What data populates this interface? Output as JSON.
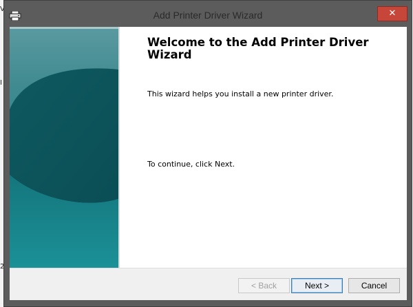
{
  "window": {
    "title": "Add Printer Driver Wizard",
    "close_glyph": "✕",
    "icon": "printer-icon"
  },
  "desktop_edge": {
    "marks": [
      "V",
      "I",
      "2"
    ]
  },
  "wizard": {
    "heading": "Welcome to the Add Printer Driver Wizard",
    "intro": "This wizard helps you install a new printer driver.",
    "instruction": "To continue, click Next."
  },
  "buttons": {
    "back": "< Back",
    "next": "Next >",
    "cancel": "Cancel"
  },
  "colors": {
    "close_button": "#c7463a",
    "panel_light": "#4f9ea4",
    "panel_dark": "#0f5c63",
    "panel_teal": "#1c8e95",
    "default_button_border": "#3c7fb1"
  }
}
